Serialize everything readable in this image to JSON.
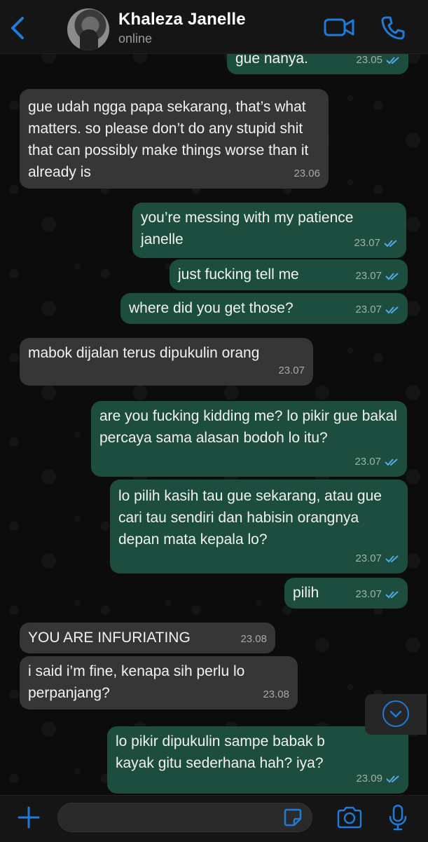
{
  "header": {
    "contact_name": "Khaleza Janelle",
    "status": "online"
  },
  "messages": [
    {
      "dir": "out",
      "text": "gue nanya.",
      "time": "23.05",
      "read": true
    },
    {
      "dir": "in",
      "text": "gue udah ngga papa sekarang, that’s what matters. so please don’t do any stupid shit that can possibly make things worse than it already is",
      "time": "23.06"
    },
    {
      "dir": "out",
      "text": "you’re messing with my patience janelle",
      "time": "23.07",
      "read": true
    },
    {
      "dir": "out",
      "text": "just fucking tell me",
      "time": "23.07",
      "read": true
    },
    {
      "dir": "out",
      "text": "where did you get those?",
      "time": "23.07",
      "read": true
    },
    {
      "dir": "in",
      "text": "mabok dijalan terus dipukulin orang",
      "time": "23.07"
    },
    {
      "dir": "out",
      "text": "are you fucking kidding me? lo pikir gue bakal percaya sama alasan bodoh lo itu?",
      "time": "23.07",
      "read": true
    },
    {
      "dir": "out",
      "text": "lo pilih kasih tau gue sekarang, atau gue cari tau sendiri dan habisin orangnya depan mata kepala lo?",
      "time": "23.07",
      "read": true
    },
    {
      "dir": "out",
      "text": "pilih",
      "time": "23.07",
      "read": true
    },
    {
      "dir": "in",
      "text": "YOU ARE INFURIATING",
      "time": "23.08"
    },
    {
      "dir": "in",
      "text": "i said i’m fine, kenapa sih perlu lo perpanjang?",
      "time": "23.08"
    },
    {
      "dir": "out",
      "text": "lo pikir dipukulin sampe babak b\nkayak gitu sederhana hah? iya?",
      "time": "23.09",
      "read": true
    }
  ],
  "input": {
    "value": "",
    "placeholder": ""
  },
  "icons": {
    "back": "chevron-left-icon",
    "video": "video-camera-icon",
    "phone": "phone-icon",
    "scroll": "chevron-down-circle-icon",
    "plus": "plus-icon",
    "sticker": "sticker-icon",
    "camera": "camera-icon",
    "mic": "microphone-icon"
  },
  "colors": {
    "accent": "#1e7bd8",
    "bubble_in": "#363636",
    "bubble_out": "#1d4d3f",
    "read_ticks": "#53a8e6"
  }
}
